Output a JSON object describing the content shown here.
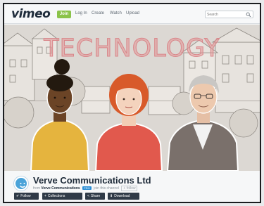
{
  "header": {
    "logo": "vimeo",
    "join_label": "Join",
    "nav": [
      "Log In",
      "Create",
      "Watch",
      "Upload"
    ],
    "search_placeholder": "Search"
  },
  "banner": {
    "title": "TECHNOLOGY"
  },
  "channel": {
    "name": "Verve Communications Ltd",
    "from_label": "from",
    "owner": "Verve Communications",
    "badge": "PRO",
    "extra_text": "join this channel",
    "extra_badge": "+ follow"
  },
  "actions": {
    "follow": "Follow",
    "collections": "Collections",
    "share": "Share",
    "download": "Download"
  },
  "colors": {
    "accent": "#8bc34a",
    "brand": "#1e2b3a",
    "button": "#2f3a47",
    "avatar": "#4aa3d9"
  }
}
